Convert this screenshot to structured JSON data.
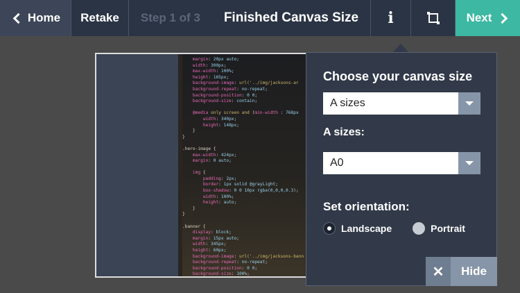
{
  "header": {
    "home_label": "Home",
    "retake_label": "Retake",
    "step_label": "Step 1 of 3",
    "title": "Finished Canvas Size",
    "info_glyph": "i",
    "next_label": "Next"
  },
  "popover": {
    "heading": "Choose your canvas size",
    "size_family_value": "A sizes",
    "sizes_heading": "A sizes:",
    "size_value": "A0",
    "orientation_heading": "Set orientation:",
    "orientation_options": [
      {
        "label": "Landscape",
        "selected": true
      },
      {
        "label": "Portrait",
        "selected": false
      }
    ],
    "hide_label": "Hide",
    "hide_glyph": "✕"
  },
  "icons": {
    "home": "chevron-left-icon",
    "info": "info-icon",
    "crop": "crop-icon",
    "next": "chevron-right-icon",
    "dropdown": "caret-down-icon",
    "hide": "close-icon"
  },
  "colors": {
    "topbar": "#2b3444",
    "accent": "#3cb8a3",
    "popover": "#323a49",
    "select_arrow": "#8795a8"
  }
}
